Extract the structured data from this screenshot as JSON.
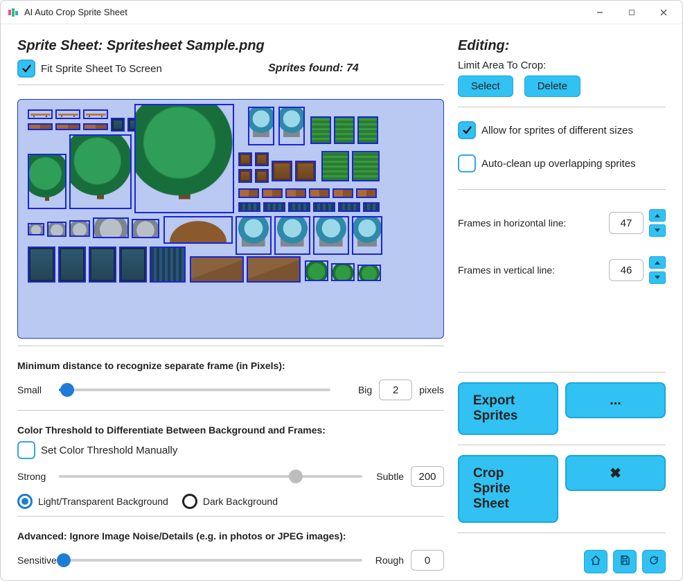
{
  "window": {
    "title": "AI Auto Crop Sprite Sheet"
  },
  "header": {
    "sheet_label": "Sprite Sheet: Spritesheet Sample.png",
    "fit_label": "Fit Sprite Sheet To Screen",
    "fit_checked": true,
    "sprites_found_label": "Sprites found: 74"
  },
  "min_distance": {
    "section": "Minimum distance to recognize separate frame (in Pixels):",
    "left": "Small",
    "right": "Big",
    "value": "2",
    "unit": "pixels",
    "percent": 3
  },
  "threshold": {
    "section": "Color Threshold to Differentiate Between Background and Frames:",
    "manual_label": "Set Color Threshold Manually",
    "manual_checked": false,
    "left": "Strong",
    "right": "Subtle",
    "value": "200",
    "percent": 78,
    "radio_light": "Light/Transparent Background",
    "radio_dark": "Dark Background",
    "radio_selected": "light"
  },
  "noise": {
    "section": "Advanced: Ignore Image Noise/Details (e.g. in photos or JPEG images):",
    "left": "Sensitive",
    "right": "Rough",
    "value": "0",
    "percent": 0
  },
  "editing": {
    "heading": "Editing:",
    "limit_label": "Limit Area To Crop:",
    "select_btn": "Select",
    "delete_btn": "Delete",
    "allow_sizes_label": "Allow for sprites of different sizes",
    "allow_sizes_checked": true,
    "auto_clean_label": "Auto-clean up overlapping sprites",
    "auto_clean_checked": false,
    "frames_h_label": "Frames in horizontal line:",
    "frames_h_value": "47",
    "frames_v_label": "Frames in vertical line:",
    "frames_v_value": "46"
  },
  "actions": {
    "export": "Export Sprites",
    "export_more": "...",
    "crop": "Crop Sprite Sheet",
    "cancel_icon": "✖"
  },
  "palette": {
    "accent": "#31c2f3",
    "accent_border": "#1aa7da",
    "slider_blue": "#1e7bd6",
    "sprite_border": "#1a25d6",
    "preview_bg": "#b9c9f1"
  }
}
